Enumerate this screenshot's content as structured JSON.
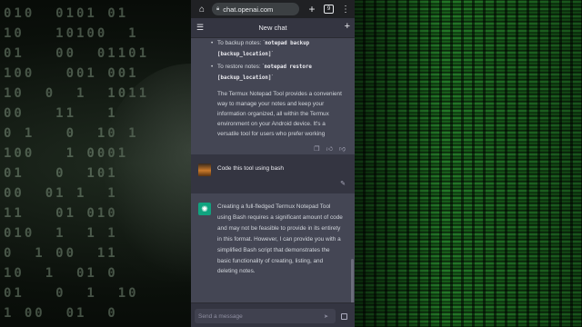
{
  "browser": {
    "home_icon": "home-icon",
    "url": "chat.openai.com",
    "tab_count": "9"
  },
  "header": {
    "title": "New chat"
  },
  "assistant_1": {
    "bullets": [
      {
        "prefix": "To backup notes: `",
        "code": "notepad backup [backup_location]",
        "suffix": "`"
      },
      {
        "prefix": "To restore notes: `",
        "code": "notepad restore [backup_location]",
        "suffix": "`"
      }
    ],
    "paragraph": "The Termux Notepad Tool provides a convenient way to manage your notes and keep your information organized, all within the Termux environment on your Android device. It's a versatile tool for users who prefer working"
  },
  "user_message": {
    "text": "Code this tool using bash"
  },
  "assistant_2": {
    "paragraph": "Creating a full-fledged Termux Notepad Tool using Bash requires a significant amount of code and may not be feasible to provide in its entirety in this format. However, I can provide you with a simplified Bash script that demonstrates the basic functionality of creating, listing, and deleting notes."
  },
  "composer": {
    "placeholder": "Send a message"
  },
  "background": {
    "binary": "010  0101 01\n10   10100  1\n01   00  01101\n100   001 001\n10  0  1  1011\n00   11   1\n0 1   0  10 1\n100   1 0001\n01   0  101\n00  01 1  1\n11   01 010\n010  1  1 1\n0  1 00  11\n10  1  01 0\n01   0  1  10\n1 00  01  0\n00  1  10  1"
  }
}
